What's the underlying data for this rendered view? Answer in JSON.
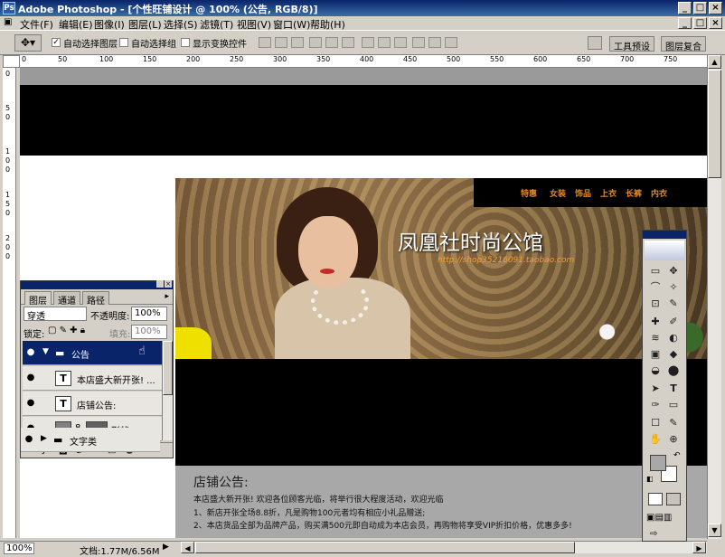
{
  "window": {
    "title": "Adobe Photoshop - [个性旺铺设计 @ 100% (公告, RGB/8)]",
    "app_icon": "Ps",
    "btn_min": "_",
    "btn_max": "□",
    "btn_close": "×",
    "doc_btn_min": "_",
    "doc_btn_max": "□",
    "doc_btn_close": "×"
  },
  "menu": [
    "文件(F)",
    "编辑(E)",
    "图像(I)",
    "图层(L)",
    "选择(S)",
    "滤镜(T)",
    "视图(V)",
    "窗口(W)",
    "帮助(H)"
  ],
  "options": {
    "tool_icon": "move-tool-icon",
    "auto_select_layer": "自动选择图层",
    "auto_select_group": "自动选择组",
    "show_transform": "显示变换控件",
    "auto_select_layer_checked": true,
    "auto_select_group_checked": false,
    "show_transform_checked": false,
    "palette_tab1": "工具预设",
    "palette_tab2": "图层复合"
  },
  "ruler": {
    "h": [
      "0",
      "50",
      "100",
      "150",
      "200",
      "250",
      "300",
      "350",
      "400",
      "450",
      "500",
      "550",
      "600",
      "650",
      "700",
      "750"
    ],
    "v": [
      "0",
      "5",
      "0",
      "1",
      "0",
      "0",
      "1",
      "5",
      "0",
      "2",
      "0",
      "0"
    ]
  },
  "banner": {
    "nav": [
      "特惠",
      "女装",
      "饰品",
      "上衣",
      "长裤",
      "内衣"
    ],
    "title": "凤凰社时尚公馆",
    "url": "http://shop35216091.taobao.com"
  },
  "notice": {
    "heading": "店铺公告:",
    "lines": [
      "本店盛大新开张! 欢迎各位顾客光临，将举行很大程度活动，欢迎光临",
      "1、新店开张全场8.8折，凡是购物100元者均有相应小礼品赠送;",
      "2、本店货品全部为品牌产品，购买满500元即自动成为本店会员，再购物将享受VIP折扣价格，优惠多多!"
    ]
  },
  "status": {
    "zoom": "100%",
    "doc": "文档:1.77M/6.56M"
  },
  "layers": {
    "tabs": [
      "图层",
      "通道",
      "路径"
    ],
    "blend_mode": "穿透",
    "opacity_label": "不透明度:",
    "opacity": "100%",
    "lock_label": "锁定:",
    "fill_label": "填充:",
    "fill": "100%",
    "rows": [
      {
        "name": "公告",
        "kind": "group"
      },
      {
        "name": "本店盛大新开张! ...",
        "kind": "text"
      },
      {
        "name": "店铺公告:",
        "kind": "text"
      },
      {
        "name": "形状 3",
        "kind": "shape"
      },
      {
        "name": "文字类",
        "kind": "group"
      }
    ]
  },
  "tools": [
    "▭",
    "✥",
    "⌒",
    "✧",
    "⊡",
    "✎",
    "✚",
    "✐",
    "≋",
    "◐",
    "▣",
    "◆",
    "◒",
    "⬤",
    "➤",
    "T",
    "✑",
    "▭",
    "☐",
    "✎",
    "✋",
    "⊕"
  ]
}
